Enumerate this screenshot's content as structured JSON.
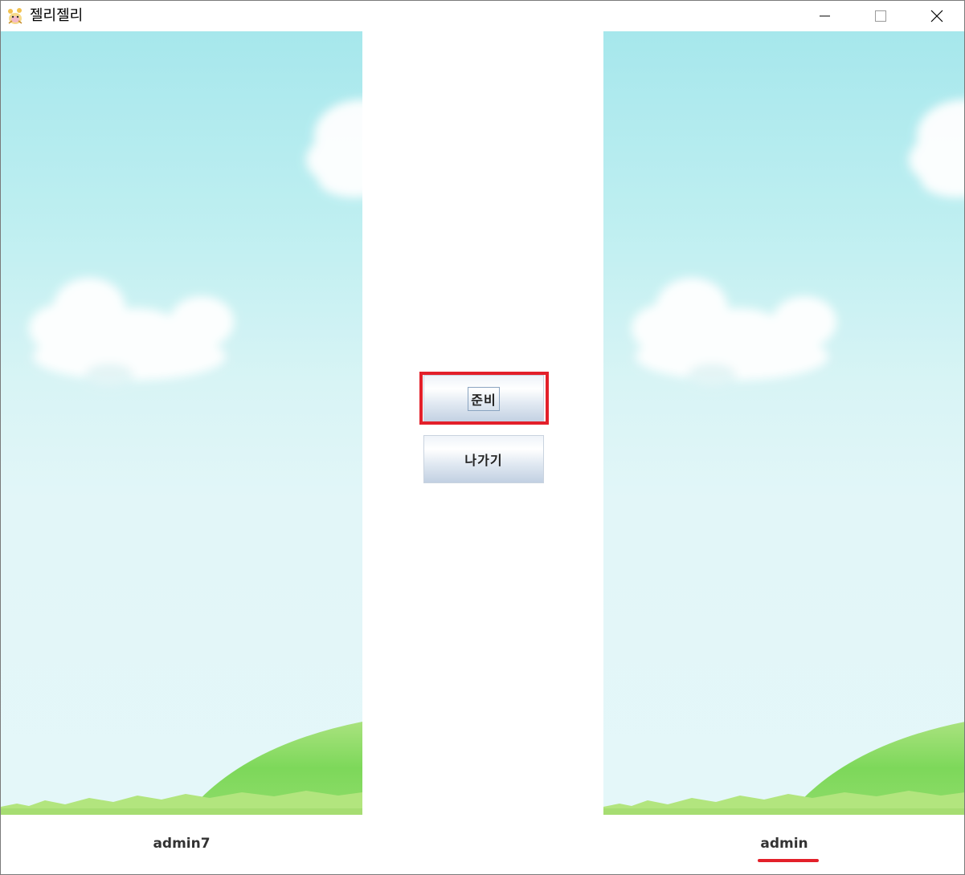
{
  "window": {
    "title": "젤리젤리",
    "icon": "jelly-app-icon",
    "controls": [
      "minimize-icon",
      "maximize-icon",
      "close-icon"
    ]
  },
  "buttons": {
    "ready_label": "준비",
    "exit_label": "나가기"
  },
  "players": {
    "left_name": "admin7",
    "right_name": "admin"
  },
  "colors": {
    "annotation_red": "#e3202a",
    "sky_top": "#a6e7ec",
    "sky_bottom": "#e4f7f9",
    "grass": "#7ed957"
  }
}
